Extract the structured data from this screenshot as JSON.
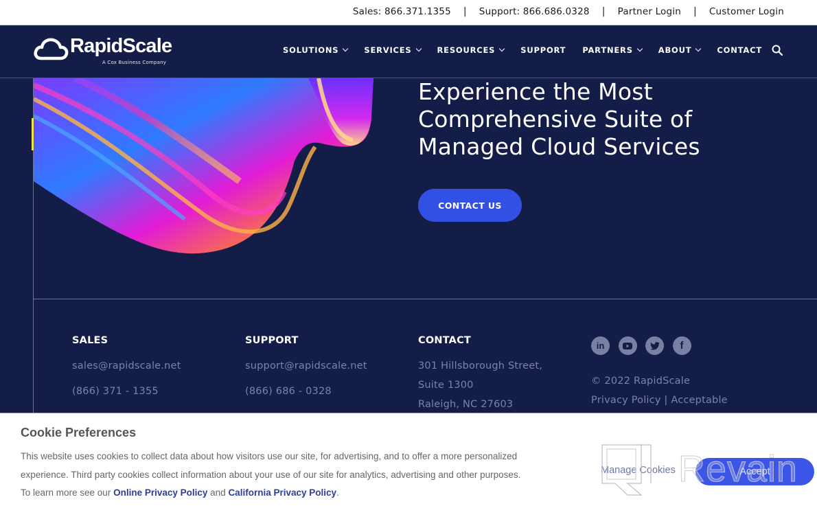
{
  "utility_bar": {
    "items": [
      {
        "label": "Sales: 866.371.1355"
      },
      {
        "label": "Support: 866.686.0328"
      },
      {
        "label": "Partner Login"
      },
      {
        "label": "Customer Login"
      }
    ],
    "separator": "|"
  },
  "brand": {
    "name": "RapidScale",
    "tagline": "A Cox Business Company"
  },
  "nav": {
    "items": [
      {
        "label": "SOLUTIONS",
        "has_dropdown": true
      },
      {
        "label": "SERVICES",
        "has_dropdown": true
      },
      {
        "label": "RESOURCES",
        "has_dropdown": true
      },
      {
        "label": "SUPPORT",
        "has_dropdown": false
      },
      {
        "label": "PARTNERS",
        "has_dropdown": true
      },
      {
        "label": "ABOUT",
        "has_dropdown": true
      },
      {
        "label": "CONTACT",
        "has_dropdown": false
      }
    ],
    "search_icon": "search-icon"
  },
  "hero": {
    "title": "Experience the Most Comprehensive Suite of Managed Cloud Services",
    "cta_label": "CONTACT US"
  },
  "footer": {
    "sales": {
      "heading": "SALES",
      "email": "sales@rapidscale.net",
      "phone": "(866) 371 - 1355"
    },
    "support": {
      "heading": "SUPPORT",
      "email": "support@rapidscale.net",
      "phone": "(866) 686 - 0328"
    },
    "contact": {
      "heading": "CONTACT",
      "address_line1": "301 Hillsborough Street,",
      "address_line2": "Suite 1300",
      "address_line3": "Raleigh, NC 27603"
    },
    "social": [
      {
        "name": "linkedin",
        "glyph": "in"
      },
      {
        "name": "youtube",
        "glyph": "▶"
      },
      {
        "name": "twitter",
        "glyph": "t"
      },
      {
        "name": "facebook",
        "glyph": "f"
      }
    ],
    "copyright": "© 2022 RapidScale",
    "privacy_link": "Privacy Policy",
    "legal_separator": " | ",
    "acceptable_link": "Acceptable"
  },
  "cookie_banner": {
    "title": "Cookie Preferences",
    "text_part1": "This website uses cookies to collect data about how visitors use our site, for advertising, and to offer a more personalized experience. Third party cookies collect information about your use of our site for analytics, advertising and other purposes. To learn more see our ",
    "online_privacy_link": "Online Privacy Policy",
    "text_and": " and ",
    "california_privacy_link": "California Privacy Policy",
    "text_end": ".",
    "manage_label": "Manage Cookies",
    "accept_label": "Accept"
  },
  "watermark": {
    "text": "Revain"
  },
  "colors": {
    "navy": "#141c48",
    "cta_blue": "#3350e5",
    "accent_yellow": "#f2e64a",
    "muted_text": "#7a84a8",
    "link_blue": "#2b3e9e"
  }
}
